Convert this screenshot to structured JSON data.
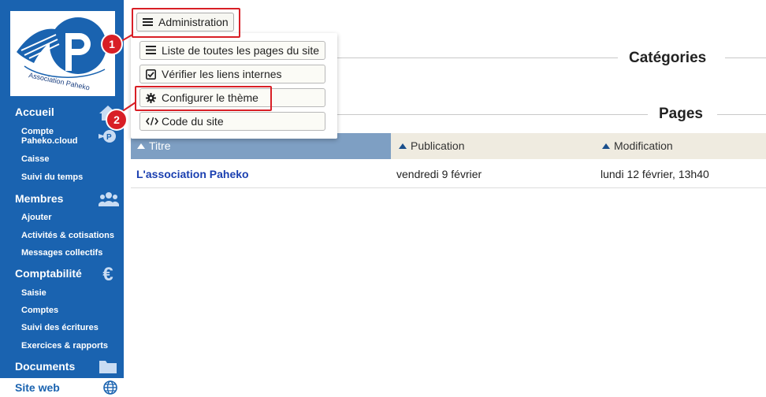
{
  "logo": {
    "text": "Association Paheko",
    "letter": "P"
  },
  "sidebar": {
    "sections": [
      {
        "label": "Accueil",
        "icon": "home-icon",
        "items": [
          {
            "label": "Compte",
            "label2": "Paheko.cloud"
          },
          {
            "label": "Caisse"
          },
          {
            "label": "Suivi du temps"
          }
        ]
      },
      {
        "label": "Membres",
        "icon": "users-icon",
        "items": [
          {
            "label": "Ajouter"
          },
          {
            "label": "Activités & cotisations"
          },
          {
            "label": "Messages collectifs"
          }
        ]
      },
      {
        "label": "Comptabilité",
        "icon": "euro-icon",
        "items": [
          {
            "label": "Saisie"
          },
          {
            "label": "Comptes"
          },
          {
            "label": "Suivi des écritures"
          },
          {
            "label": "Exercices & rapports"
          }
        ]
      },
      {
        "label": "Documents",
        "icon": "folder-icon",
        "items": []
      }
    ],
    "active": {
      "label": "Site web",
      "icon": "globe-icon"
    }
  },
  "toolbar": {
    "admin_label": "Administration"
  },
  "dropdown": {
    "items": [
      {
        "label": "Liste de toutes les pages du site",
        "icon": "list-icon"
      },
      {
        "label": "Vérifier les liens internes",
        "icon": "checkbox-icon"
      },
      {
        "label": "Configurer le thème",
        "icon": "gear-icon"
      },
      {
        "label": "Code du site",
        "icon": "code-icon"
      }
    ]
  },
  "annotations": {
    "badge1": "1",
    "badge2": "2",
    "color": "#d81f26"
  },
  "main": {
    "categories_title": "Catégories",
    "pages_title": "Pages",
    "columns": [
      {
        "label": "Titre"
      },
      {
        "label": "Publication"
      },
      {
        "label": "Modification"
      }
    ],
    "rows": [
      {
        "title": "L'association Paheko",
        "published": "vendredi 9 février",
        "modified": "lundi 12 février, 13h40"
      }
    ]
  },
  "colors": {
    "sidebar": "#1a63b0",
    "accent": "#d81f26",
    "link": "#1a3fb0"
  }
}
